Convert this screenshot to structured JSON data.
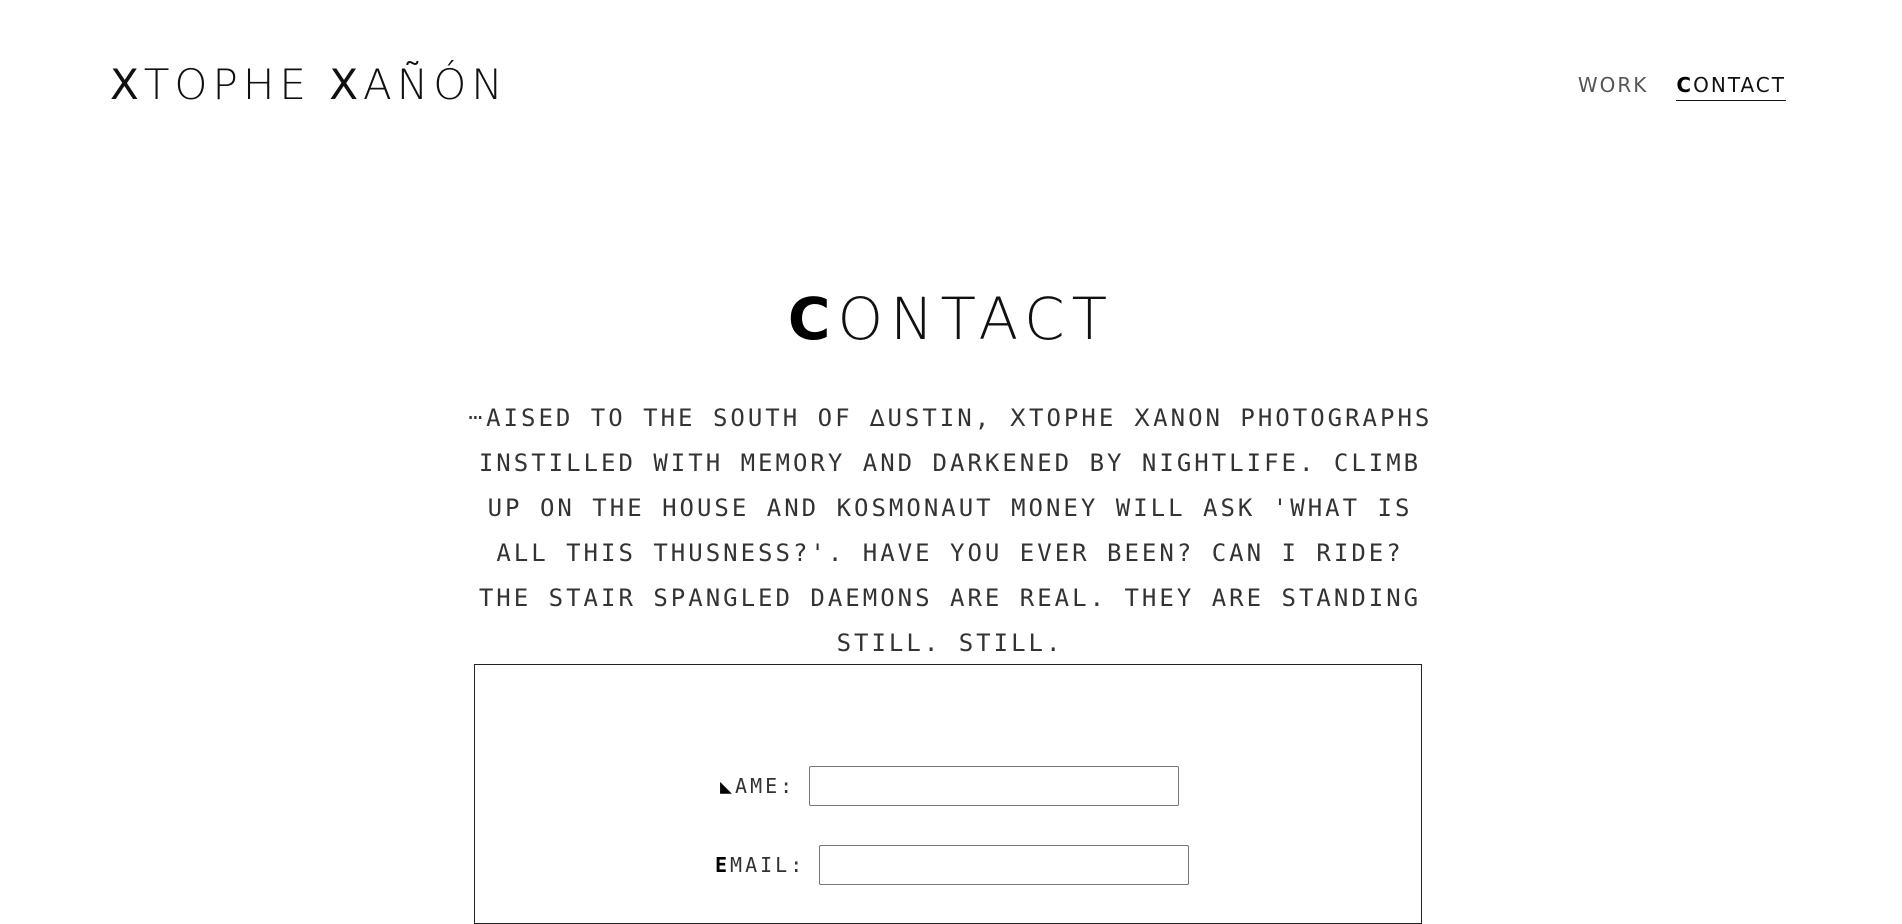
{
  "header": {
    "logo": "ⵝTOPHE ⵝAÑÓN",
    "nav": [
      {
        "cap": "",
        "rest": "WORK",
        "active": false
      },
      {
        "cap": "C",
        "rest": "ONTACT",
        "active": true
      }
    ]
  },
  "main": {
    "title": {
      "cap": "C",
      "rest": "ONTACT"
    },
    "bio": "ⵈaised to the south of ∆ustin, ⵝtophe ⵝanon photographs instilled with memory and darkened by nightlife. Climb up on the house and kosmonaut money will ask 'what is all this thusness?'. Have you ever been? Can I ride? The stair spangled daemons are real. They are standing still. Still."
  },
  "form": {
    "name": {
      "cap": "◣",
      "rest": "AME:",
      "value": ""
    },
    "email": {
      "cap": "E",
      "rest": "MAIL:",
      "value": ""
    }
  }
}
